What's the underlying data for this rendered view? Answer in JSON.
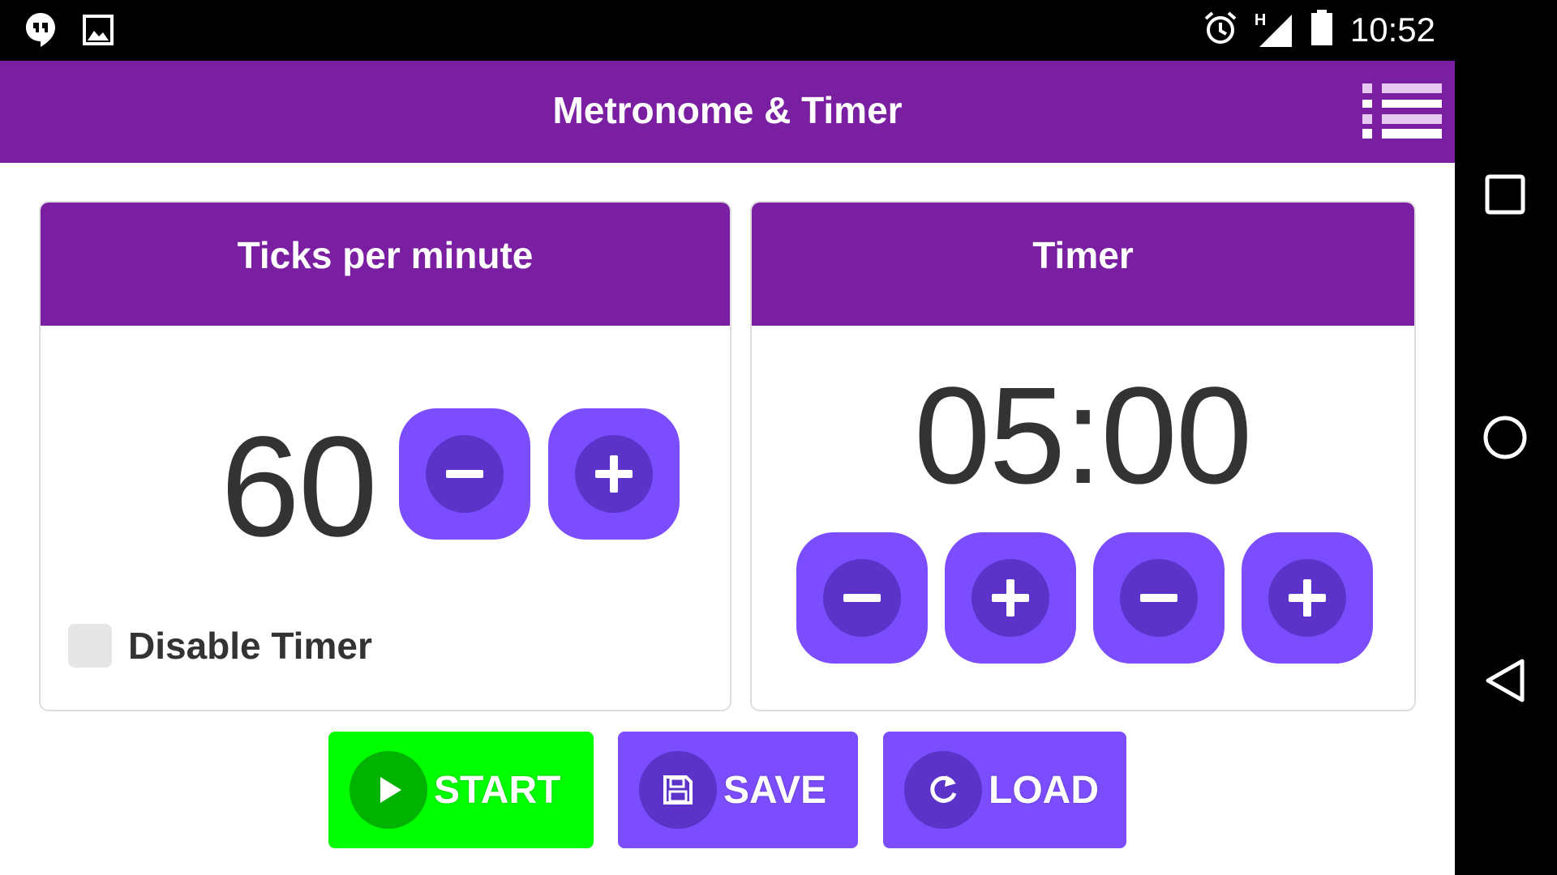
{
  "status_bar": {
    "time": "10:52",
    "network_label": "H",
    "icons": [
      "hangouts-icon",
      "image-icon",
      "alarm-icon",
      "signal-icon",
      "battery-icon"
    ]
  },
  "app_bar": {
    "title": "Metronome & Timer",
    "menu_icon": "list-menu-icon"
  },
  "ticks_card": {
    "header": "Ticks per minute",
    "value": "60",
    "disable_timer_label": "Disable Timer",
    "disable_timer_checked": false
  },
  "timer_card": {
    "header": "Timer",
    "value": "05:00"
  },
  "actions": {
    "start_label": "START",
    "save_label": "SAVE",
    "load_label": "LOAD"
  },
  "colors": {
    "primary": "#7b1fa2",
    "accent": "#7c4dff",
    "accent_dark": "#5c33c9",
    "start_green": "#00ff00",
    "start_green_dark": "#00b300"
  },
  "nav_bar": {
    "icons": [
      "recents-square-icon",
      "home-circle-icon",
      "back-triangle-icon"
    ]
  }
}
